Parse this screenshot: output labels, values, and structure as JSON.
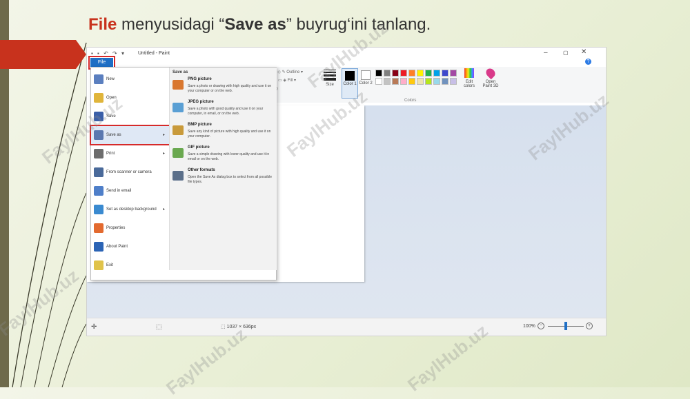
{
  "slide": {
    "title_file": "File",
    "title_part1": " menyusidagi “",
    "title_save": "Save as",
    "title_part2": "” buyrug‘ini tanlang."
  },
  "window": {
    "title": "Untitled - Paint",
    "file_tab": "File",
    "help": "?"
  },
  "ribbon": {
    "outline": "Outline",
    "fill": "Fill",
    "size": "Size",
    "color1": "Color 1",
    "color2": "Color 2",
    "edit_colors": "Edit colors",
    "open_paint3d": "Open Paint 3D",
    "colors_group": "Colors",
    "palette_row1": [
      "#000000",
      "#7f7f7f",
      "#880015",
      "#ed1c24",
      "#ff7f27",
      "#fff200",
      "#22b14c",
      "#00a2e8",
      "#3f48cc",
      "#a349a4"
    ],
    "palette_row2": [
      "#ffffff",
      "#c3c3c3",
      "#b97a57",
      "#ffaec9",
      "#ffc90e",
      "#efe4b0",
      "#b5e61d",
      "#99d9ea",
      "#7092be",
      "#c8bfe7"
    ]
  },
  "file_menu": {
    "items": [
      {
        "label": "New",
        "icon": "new-file-icon"
      },
      {
        "label": "Open",
        "icon": "open-folder-icon"
      },
      {
        "label": "Save",
        "icon": "save-disk-icon"
      },
      {
        "label": "Save as",
        "icon": "save-as-icon",
        "arrow": "▸"
      },
      {
        "label": "Print",
        "icon": "printer-icon",
        "arrow": "▸"
      },
      {
        "label": "From scanner or camera",
        "icon": "scanner-icon"
      },
      {
        "label": "Send in email",
        "icon": "email-icon"
      },
      {
        "label": "Set as desktop background",
        "icon": "desktop-icon",
        "arrow": "▸"
      },
      {
        "label": "Properties",
        "icon": "checkmark-icon"
      },
      {
        "label": "About Paint",
        "icon": "info-icon"
      },
      {
        "label": "Exit",
        "icon": "exit-icon"
      }
    ],
    "save_as": {
      "title": "Save as",
      "items": [
        {
          "title": "PNG picture",
          "desc": "Save a photo or drawing with high quality and use it on your computer or on the web."
        },
        {
          "title": "JPEG picture",
          "desc": "Save a photo with good quality and use it on your computer, in email, or on the web."
        },
        {
          "title": "BMP picture",
          "desc": "Save any kind of picture with high quality and use it on your computer."
        },
        {
          "title": "GIF picture",
          "desc": "Save a simple drawing with lower quality and use it in email or on the web."
        },
        {
          "title": "Other formats",
          "desc": "Open the Save As dialog box to select from all possible file types."
        }
      ]
    }
  },
  "status": {
    "dimensions": "1037 × 636px",
    "zoom": "100%",
    "zoom_minus": "−",
    "zoom_plus": "+",
    "zoom_level": 0.5
  },
  "watermark": "FaylHub.uz"
}
